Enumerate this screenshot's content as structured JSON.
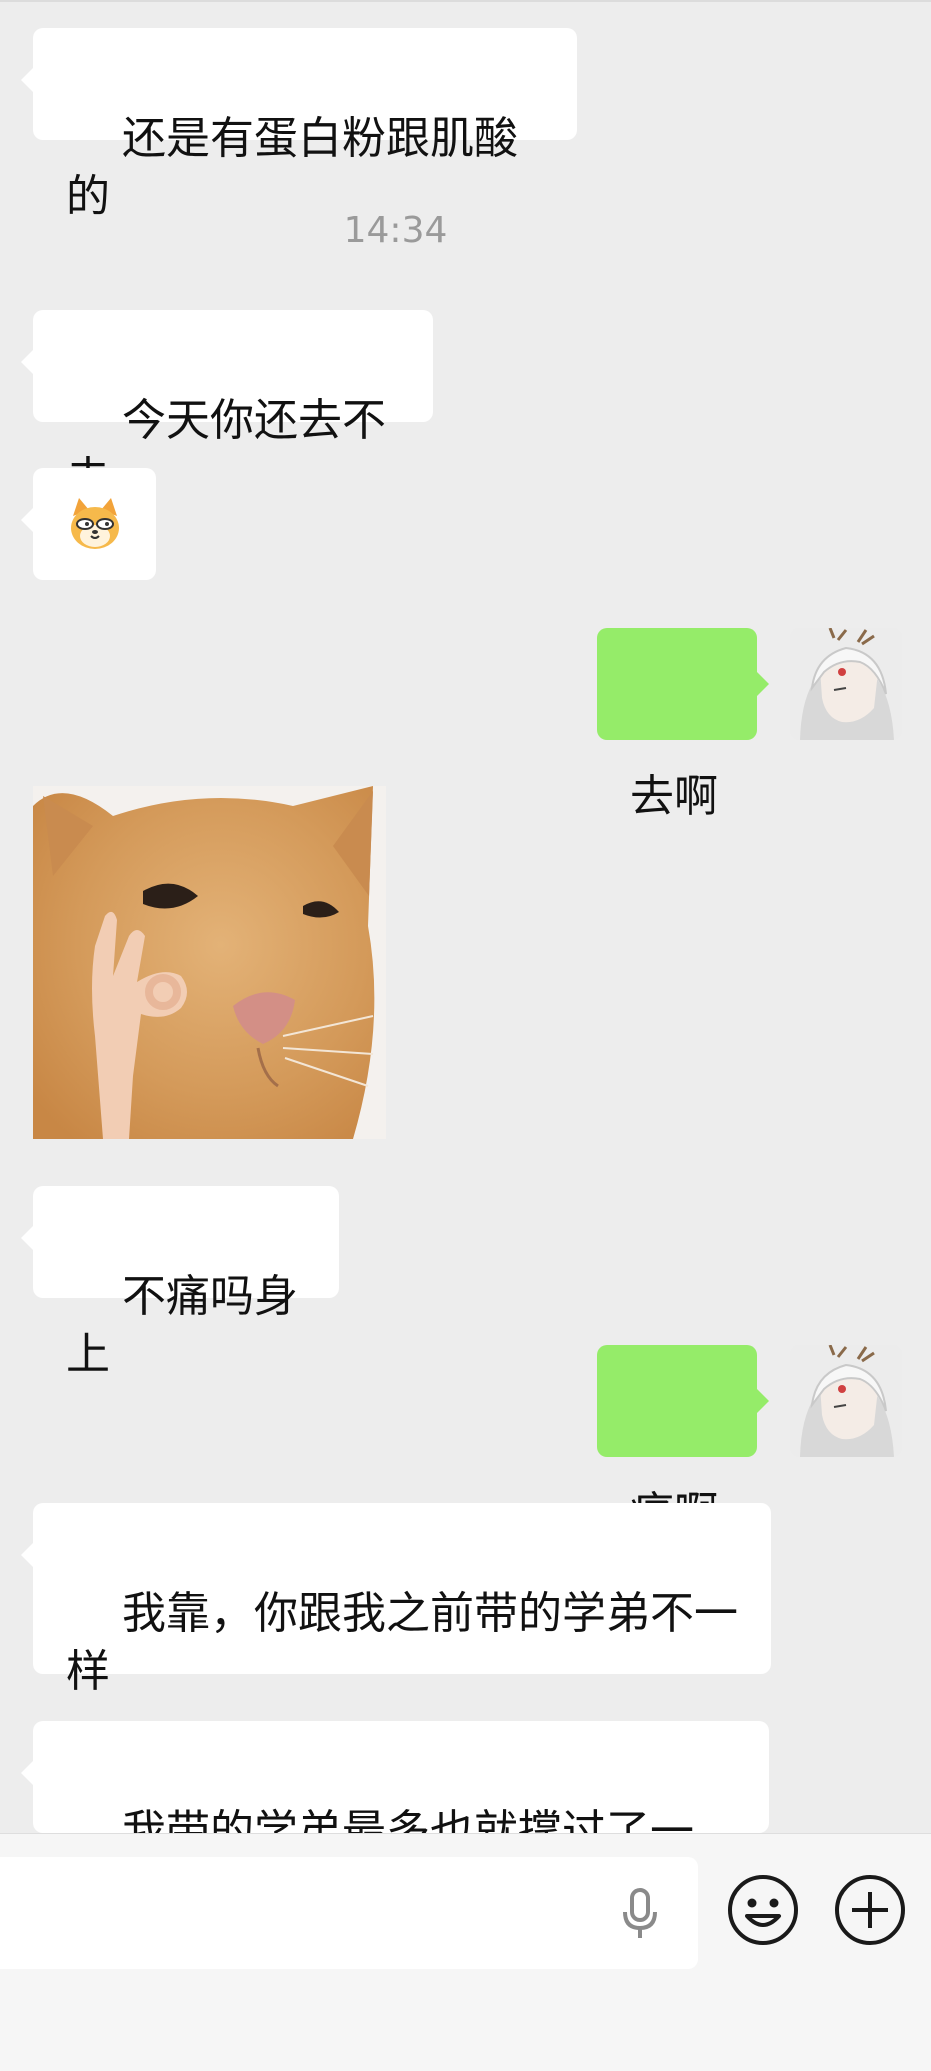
{
  "messages": {
    "m1": "还是有蛋白粉跟肌酸的",
    "time1": "14:34",
    "m2": "今天你还去不去",
    "m4": "去啊",
    "m6": "不痛吗身上",
    "m7": "痛啊",
    "m8": "我靠，你跟我之前带的学弟不一\n样",
    "m9": "我带的学弟最多也就撑过了一周"
  },
  "icons": {
    "emoji": "doge-cat-emoji",
    "sticker": "cat-ok-hand-sticker",
    "avatar": "white-haired-character-avatar",
    "voice": "microphone-icon",
    "face": "smiley-icon",
    "more": "plus-circle-icon"
  },
  "colors": {
    "background": "#ededed",
    "bubble_self": "#95ec69",
    "bubble_other": "#ffffff"
  }
}
